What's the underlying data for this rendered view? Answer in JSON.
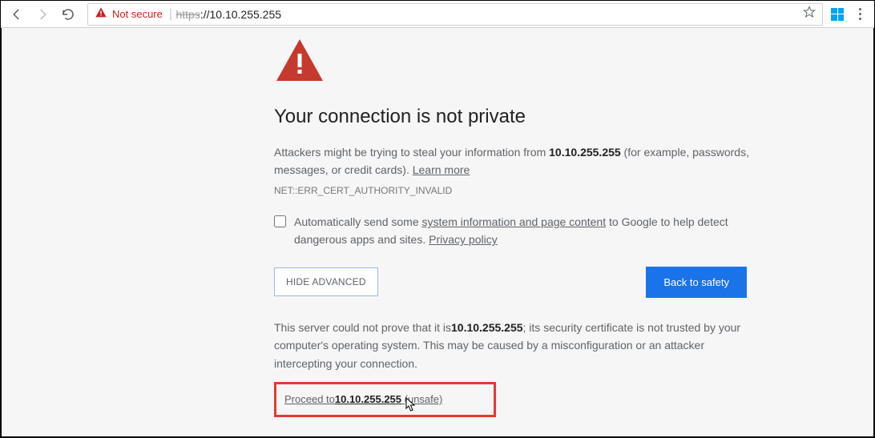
{
  "chrome": {
    "security_label": "Not secure",
    "url_scheme_struck": "https",
    "url_rest": "://10.10.255.255"
  },
  "page": {
    "title": "Your connection is not private",
    "body_text_1": "Attackers might be trying to steal your information from ",
    "body_host_bold": "10.10.255.255",
    "body_text_2": " (for example, passwords, messages, or credit cards). ",
    "learn_more": "Learn more",
    "error_code": "NET::ERR_CERT_AUTHORITY_INVALID",
    "optin_1": "Automatically send some ",
    "optin_link1": "system information and page content",
    "optin_2": " to Google to help detect dangerous apps and sites. ",
    "optin_link2": "Privacy policy",
    "btn_advanced": "HIDE ADVANCED",
    "btn_safety": "Back to safety",
    "detail_1": "This server could not prove that it is",
    "detail_host": "10.10.255.255",
    "detail_2": "; its security certificate is not trusted by your computer's operating system. This may be caused by a misconfiguration or an attacker intercepting your connection.",
    "proceed_1": "Proceed to",
    "proceed_host": "10.10.255.255",
    "proceed_2": "(unsafe)"
  }
}
